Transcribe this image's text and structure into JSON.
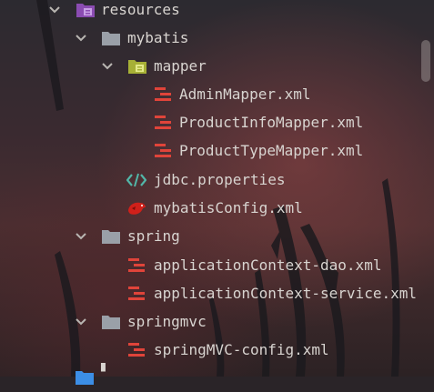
{
  "tree": {
    "resources": "resources",
    "mybatis": "mybatis",
    "mapper": "mapper",
    "admin_mapper": "AdminMapper.xml",
    "productinfo_mapper": "ProductInfoMapper.xml",
    "producttype_mapper": "ProductTypeMapper.xml",
    "jdbc_properties": "jdbc.properties",
    "mybatis_config": "mybatisConfig.xml",
    "spring": "spring",
    "app_context_dao": "applicationContext-dao.xml",
    "app_context_service": "applicationContext-service.xml",
    "springmvc": "springmvc",
    "springmvc_config": "springMVC-config.xml",
    "partial_next": "..."
  },
  "icons": {
    "folder": "folder-icon",
    "resources_folder": "resources-root-icon",
    "package_folder": "package-folder-icon",
    "xml_file": "xml-file-icon",
    "properties_file": "properties-file-icon",
    "mybatis_file": "mybatis-bird-icon",
    "chevron": "chevron-down-icon"
  },
  "colors": {
    "text": "#d8d4d0",
    "folder": "#9aa0a8",
    "resources_purple": "#a25acb",
    "package_yellow": "#b5c23a",
    "xml_red": "#e0443a",
    "properties_green": "#52b6a8",
    "mybatis_red": "#d0201a",
    "blue_folder": "#3c8ee6"
  }
}
